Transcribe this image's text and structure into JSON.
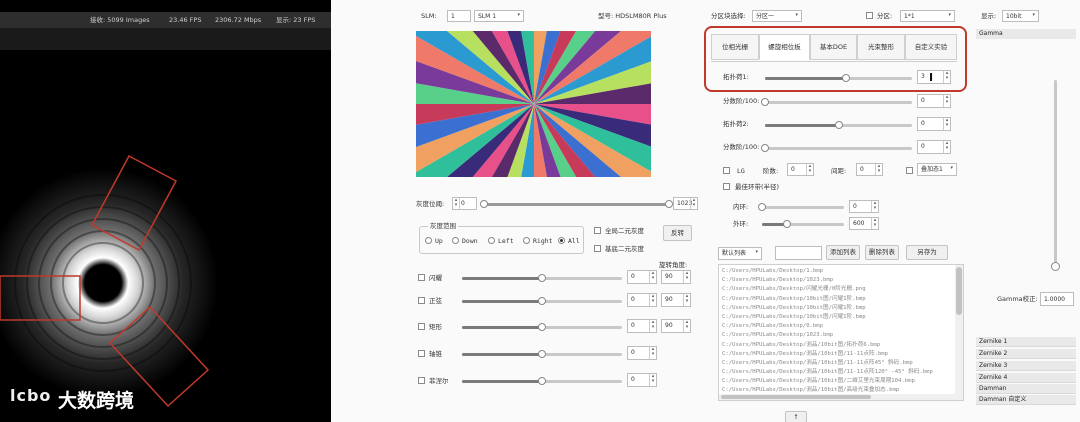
{
  "camera": {
    "status": [
      "接收: 5099 Images",
      "23.46 FPS",
      "2306.72 Mbps",
      "显示: 23 FPS"
    ],
    "watermark": "大数跨境"
  },
  "top": {
    "slm_label": "SLM:",
    "slm_index": "1",
    "slm_select": "SLM 1",
    "model": "型号: HDSLM80R Plus",
    "area_label": "分区块选择:",
    "area_select": "分区一",
    "partition_label": "分区:",
    "partition_select": "1*1",
    "display_label": "显示:",
    "display_select": "10bit"
  },
  "gray": {
    "label": "灰度位阈:",
    "low": "0",
    "high": "1023",
    "low_frac": 0.0,
    "high_frac": 1.0
  },
  "gray_range": {
    "title": "灰度范围",
    "options": [
      "Up",
      "Down",
      "Left",
      "Right",
      "All"
    ],
    "selected": "All"
  },
  "binary": {
    "full": "全局二元灰度",
    "basic": "基底二元灰度",
    "invert": "反转"
  },
  "rotation_label": "旋转角度:",
  "effects": [
    {
      "label": "闪耀",
      "value": "0",
      "angle": "90",
      "frac": 0.5
    },
    {
      "label": "正弦",
      "value": "0",
      "angle": "90",
      "frac": 0.5
    },
    {
      "label": "矩形",
      "value": "0",
      "angle": "90",
      "frac": 0.5
    },
    {
      "label": "轴锥",
      "value": "0",
      "angle": "",
      "frac": 0.5
    },
    {
      "label": "菲涅尔",
      "value": "0",
      "angle": "",
      "frac": 0.5
    }
  ],
  "tabs": [
    "位相光栅",
    "螺旋相位板",
    "基本DOE",
    "光束整形",
    "自定义实验"
  ],
  "active_tab": 1,
  "spiral": {
    "rows": [
      {
        "label": "拓扑荷1:",
        "value": "3",
        "frac": 0.55
      },
      {
        "label": "分数阶/100:",
        "value": "0",
        "frac": 0.0
      },
      {
        "label": "拓扑荷2:",
        "value": "0",
        "frac": 0.5
      },
      {
        "label": "分数阶/100:",
        "value": "0",
        "frac": 0.0
      }
    ],
    "lg_label": "LG",
    "order_label": "阶数:",
    "order_value": "0",
    "spacing_label": "间距:",
    "spacing_value": "0",
    "overlay_label": "叠加态1",
    "ring_label": "最佳环带(半径)",
    "inner_label": "内环:",
    "inner_value": "0",
    "inner_frac": 0.0,
    "outer_label": "外环:",
    "outer_value": "600",
    "outer_frac": 0.3
  },
  "list": {
    "select": "默认列表",
    "add": "添加列表",
    "delete": "删除列表",
    "save_as": "另存为",
    "files": [
      "C:/Users/HPULabs/Desktop/1.bmp",
      "C:/Users/HPULabs/Desktop/1023.bmp",
      "C:/Users/HPULabs/Desktop/闪耀光栅/0阶光栅.png",
      "C:/Users/HPULabs/Desktop/10bit图/闪耀1阶.bmp",
      "C:/Users/HPULabs/Desktop/10bit图/闪耀1阶.bmp",
      "C:/Users/HPULabs/Desktop/10bit图/闪耀1阶.bmp",
      "C:/Users/HPULabs/Desktop/0.bmp",
      "C:/Users/HPULabs/Desktop/1023.bmp",
      "C:/Users/HPULabs/Desktop/测品/10bit图/拓扑荷6.bmp",
      "C:/Users/HPULabs/Desktop/测品/10bit图/11-11点阵.bmp",
      "C:/Users/HPULabs/Desktop/测品/10bit图/11-11点阵45° 斜码.bmp",
      "C:/Users/HPULabs/Desktop/测品/10bit图/11-11点阵120° -45° 斜码.bmp",
      "C:/Users/HPULabs/Desktop/测品/10bit图/二维艾里光束周期104.bmp",
      "C:/Users/HPULabs/Desktop/测品/10bit图/高级光束叠加态.bmp"
    ]
  },
  "gamma": {
    "header": "Gamma",
    "label": "Gamma校正:",
    "value": "1.0000"
  },
  "zernike": [
    "Zernike 1",
    "Zernike 2",
    "Zernike 3",
    "Zernike 4",
    "Damman",
    "Damman 自定义"
  ],
  "colors": {
    "highlight_box": "#c0392b",
    "roi_box": "#c0392b"
  }
}
